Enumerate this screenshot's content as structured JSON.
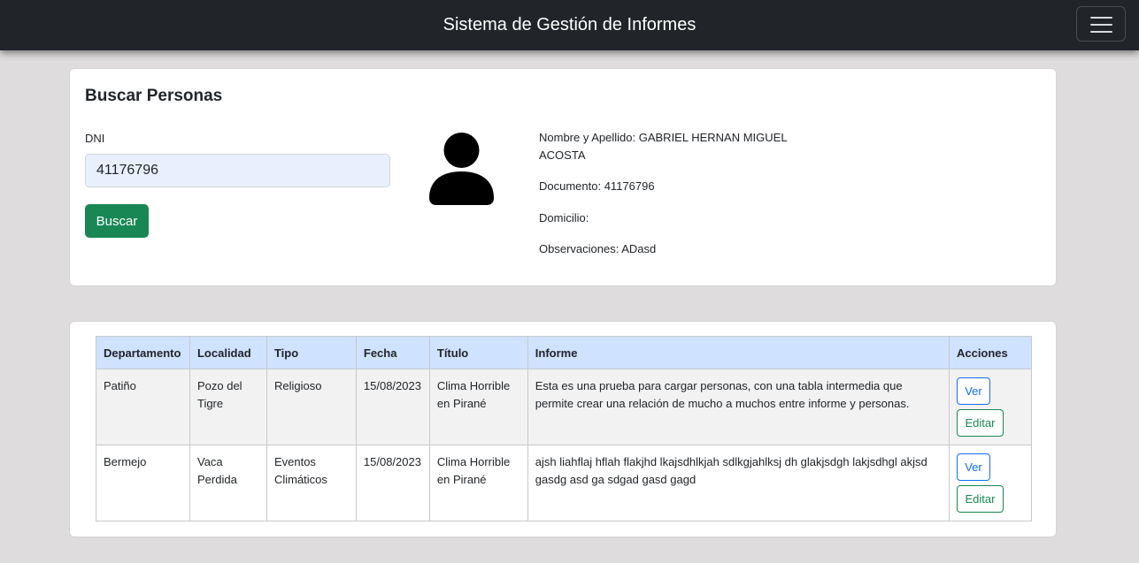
{
  "navbar": {
    "brand": "Sistema de Gestión de Informes",
    "toggler_icon": "hamburger-menu-icon"
  },
  "search": {
    "title": "Buscar Personas",
    "dni_label": "DNI",
    "dni_value": "41176796",
    "button_label": "Buscar",
    "avatar_icon": "person-icon"
  },
  "person": {
    "name_line1": "Nombre y Apellido: GABRIEL HERNAN MIGUEL",
    "name_line2": "ACOSTA",
    "documento": "Documento: 41176796",
    "domicilio": "Domicilio:",
    "observaciones": "Observaciones: ADasd"
  },
  "table": {
    "headers": [
      "Departamento",
      "Localidad",
      "Tipo",
      "Fecha",
      "Título",
      "Informe",
      "Acciones"
    ],
    "rows": [
      {
        "departamento": "Patiño",
        "localidad": "Pozo del Tigre",
        "tipo": "Religioso",
        "fecha": "15/08/2023",
        "titulo": "Clima Horrible en Pirané",
        "informe": "Esta es una prueba para cargar personas, con una tabla intermedia que permite crear una relación de mucho a muchos entre informe y personas.",
        "ver_label": "Ver",
        "editar_label": "Editar"
      },
      {
        "departamento": "Bermejo",
        "localidad": "Vaca Perdida",
        "tipo": "Eventos Climáticos",
        "fecha": "15/08/2023",
        "titulo": "Clima Horrible en Pirané",
        "informe": "ajsh liahflaj hflah flakjhd lkajsdhlkjah sdlkgjahlksj dh glakjsdgh lakjsdhgl akjsd gasdg asd ga sdgad gasd gagd",
        "ver_label": "Ver",
        "editar_label": "Editar"
      }
    ]
  },
  "colors": {
    "navbar_bg": "#212529",
    "page_bg": "#dedcdc",
    "success": "#198754",
    "primary": "#0d6efd",
    "table_header_bg": "#cfe2ff"
  }
}
